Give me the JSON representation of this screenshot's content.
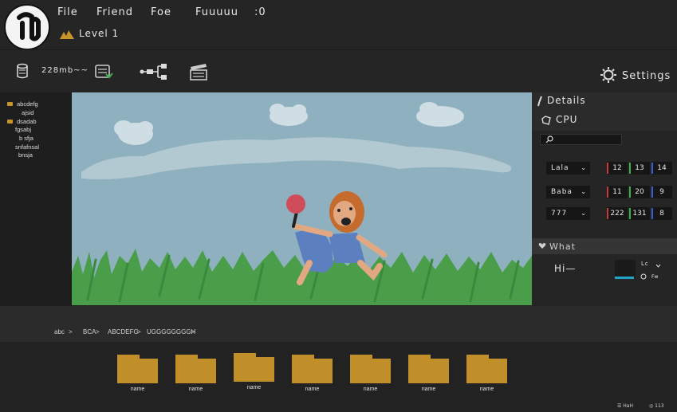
{
  "menu": [
    {
      "label": "File"
    },
    {
      "label": "Friend"
    },
    {
      "label": "Foe"
    },
    {
      "label": "Fuuuuu"
    },
    {
      "label": ":0"
    }
  ],
  "level": {
    "label": "Level 1"
  },
  "toolbar": {
    "items": [
      {
        "icon": "save-icon"
      },
      {
        "label": "228mb~~",
        "icon": "blueprint-icon"
      },
      {
        "icon": "node-graph-icon"
      },
      {
        "icon": "clapperboard-icon"
      }
    ],
    "settings_label": "Settings"
  },
  "outliner": {
    "items": [
      {
        "label": "abcdefg",
        "folder": true
      },
      {
        "label": "ajsid",
        "folder": false
      },
      {
        "label": "dsadab",
        "folder": true
      },
      {
        "label": "fgsabj",
        "folder": false
      },
      {
        "label": "b sfja",
        "folder": false
      },
      {
        "label": "snfafnsal",
        "folder": false
      },
      {
        "label": "bnsja",
        "folder": false
      }
    ]
  },
  "details": {
    "title": "Details",
    "subtitle": "CPU",
    "search_placeholder": "",
    "rows": [
      {
        "dropdown": "Lala",
        "values": [
          "12",
          "13",
          "14"
        ]
      },
      {
        "dropdown": "Baba",
        "values": [
          "11",
          "20",
          "9"
        ]
      },
      {
        "dropdown": "777",
        "values": [
          "222",
          "131",
          "8"
        ]
      }
    ],
    "axis_colors": [
      "#c23a3a",
      "#3ab04a",
      "#3a5fd0"
    ],
    "what_label": "What",
    "hi_label": "Hi—",
    "mini_label": "Lc",
    "mini_sub": "Fw"
  },
  "breadcrumb": [
    "abc",
    "BCA",
    "ABCDEFG",
    "UGGGGGGGGH"
  ],
  "breadcrumb_sep": ">",
  "folders": [
    "name",
    "name",
    "name",
    "name",
    "name",
    "name",
    "name"
  ],
  "footer": {
    "left": "HaH",
    "right": "113"
  },
  "colors": {
    "folder": "#c08f2a",
    "sky": "#8fb1bf",
    "grass": "#4a9e4a",
    "accent": "#1ea5c8"
  }
}
